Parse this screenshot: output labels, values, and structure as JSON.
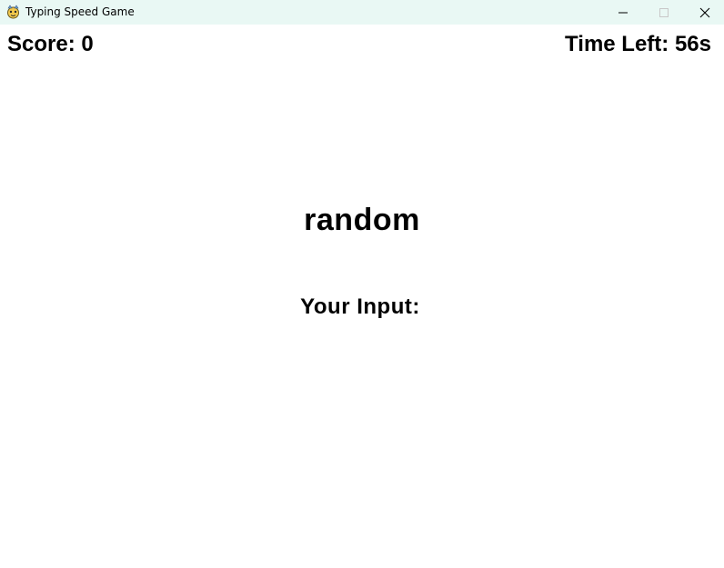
{
  "window": {
    "title": "Typing Speed Game",
    "icon": "pygame-snake-icon",
    "titlebar_color": "#e9f8f4"
  },
  "controls": {
    "minimize_icon": "minimize-icon",
    "maximize_icon": "maximize-icon",
    "close_icon": "close-icon"
  },
  "game": {
    "score_text": "Score: 0",
    "time_text": "Time Left: 56s",
    "current_word": "random",
    "input_label": "Your Input:",
    "input_value": ""
  }
}
